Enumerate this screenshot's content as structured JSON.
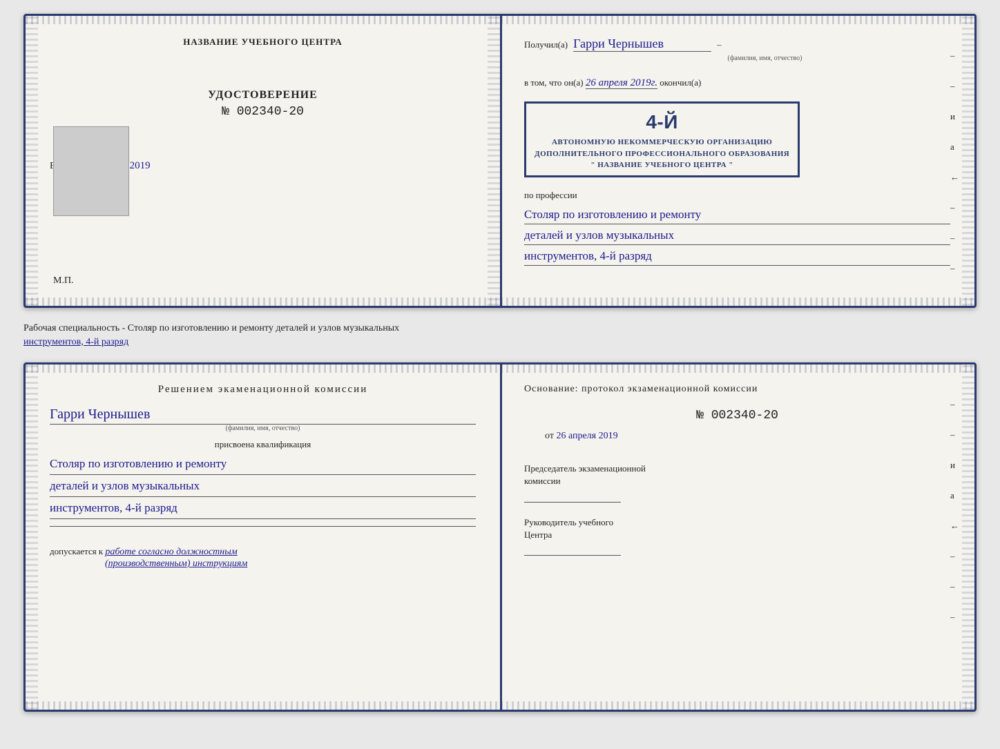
{
  "top_section": {
    "left_page": {
      "center_label": "НАЗВАНИЕ УЧЕБНОГО ЦЕНТРА",
      "udostoverenie": "УДОСТОВЕРЕНИЕ",
      "number_prefix": "№",
      "number": "002340-20",
      "vydano_label": "Выдано",
      "vydano_date": "26 апреля 2019",
      "mp_label": "М.П."
    },
    "right_page": {
      "poluchil_label": "Получил(а)",
      "recipient_name": "Гарри Чернышев",
      "fio_hint": "(фамилия, имя, отчество)",
      "v_tom_label": "в том, что он(а)",
      "date_value": "26 апреля 2019г.",
      "okonchil_label": "окончил(а)",
      "stamp_line1": "4-й",
      "stamp_line2": "АВТОНОМНУЮ НЕКОММЕРЧЕСКУЮ ОРГАНИЗАЦИЮ",
      "stamp_line3": "ДОПОЛНИТЕЛЬНОГО ПРОФЕССИОНАЛЬНОГО ОБРАЗОВАНИЯ",
      "stamp_line4": "\" НАЗВАНИЕ УЧЕБНОГО ЦЕНТРА \"",
      "po_professii_label": "по профессии",
      "profession_line1": "Столяр по изготовлению и ремонту",
      "profession_line2": "деталей и узлов музыкальных",
      "profession_line3": "инструментов, 4-й разряд"
    }
  },
  "caption": {
    "text_normal": "Рабочая специальность - Столяр по изготовлению и ремонту деталей и узлов музыкальных",
    "text_underlined": "инструментов, 4-й разряд"
  },
  "bottom_section": {
    "left_page": {
      "decision_title": "Решением  экаменационной  комиссии",
      "name": "Гарри Чернышев",
      "fio_hint": "(фамилия, имя, отчество)",
      "prisvoena_label": "присвоена квалификация",
      "qualification_line1": "Столяр по изготовлению и ремонту",
      "qualification_line2": "деталей и узлов музыкальных",
      "qualification_line3": "инструментов, 4-й разряд",
      "dopuskaetsya_label": "допускается к",
      "dopuskaetsya_value": "работе согласно должностным",
      "dopuskaetsya_value2": "(производственным) инструкциям"
    },
    "right_page": {
      "osnovaniye_label": "Основание: протокол экзаменационной  комиссии",
      "number_prefix": "№",
      "number": "002340-20",
      "ot_label": "от",
      "ot_date": "26 апреля 2019",
      "chairman_label": "Председатель экзаменационной",
      "chairman_label2": "комиссии",
      "rukovoditel_label": "Руководитель учебного",
      "rukovoditel_label2": "Центра",
      "side_letters": [
        "и",
        "а",
        "←",
        "–",
        "–",
        "–",
        "–"
      ]
    }
  }
}
